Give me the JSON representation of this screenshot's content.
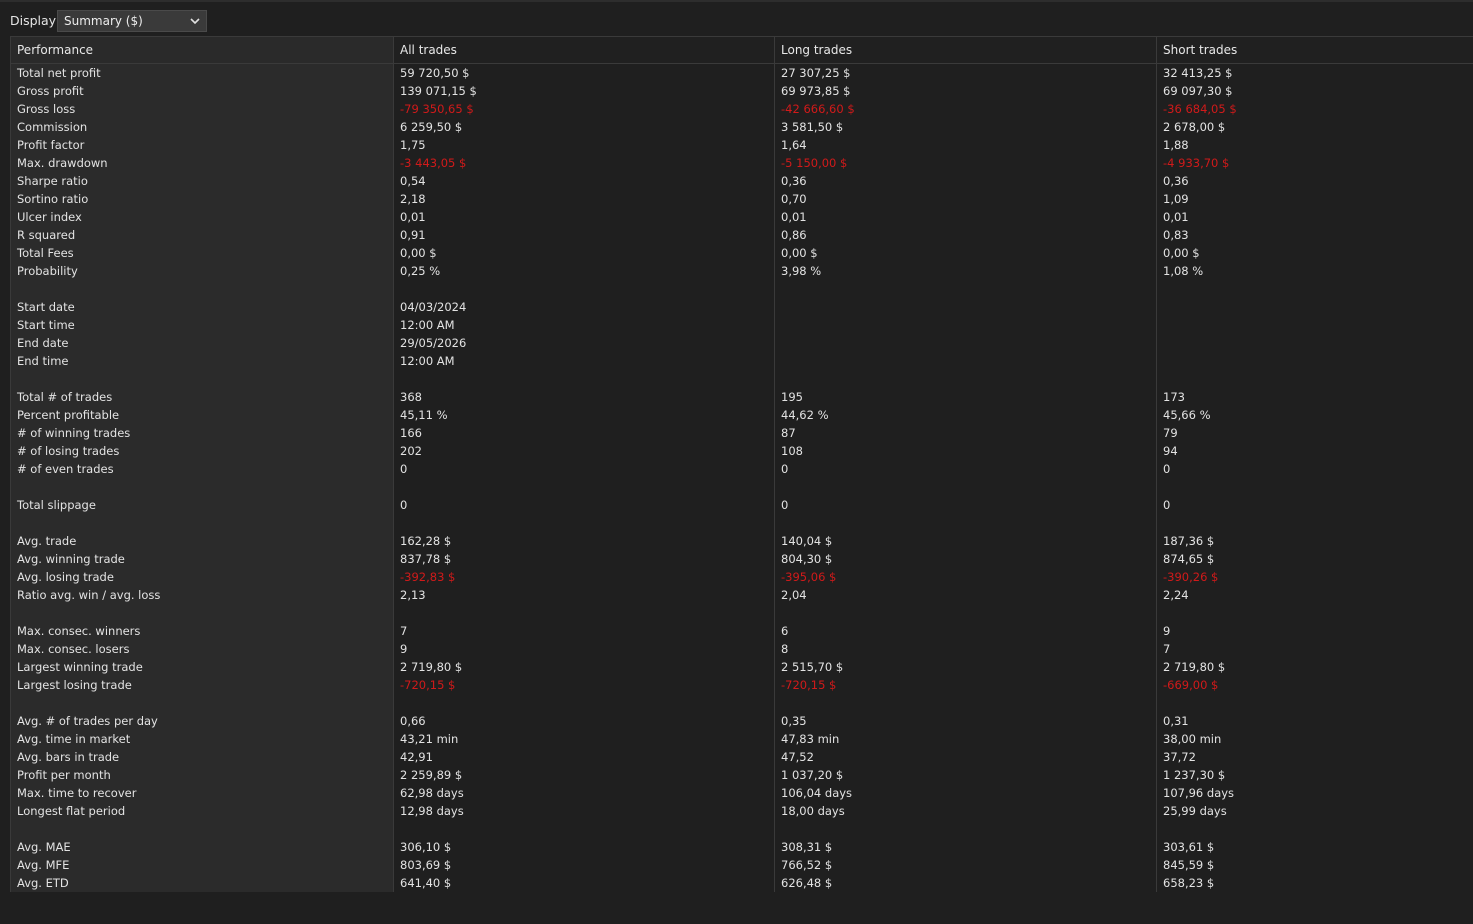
{
  "toolbar": {
    "display_label": "Display",
    "display_value": "Summary ($)",
    "chevron_icon": "chevron-down-icon"
  },
  "columns": [
    "Performance",
    "All trades",
    "Long trades",
    "Short trades"
  ],
  "colors": {
    "background": "#1f1f1f",
    "label_column": "#2b2b2b",
    "negative": "#d11a1a",
    "text": "#e3e3e3"
  },
  "rows": [
    {
      "label": "Total net profit",
      "all": "59 720,50 $",
      "long": "27 307,25 $",
      "short": "32 413,25 $",
      "neg": false
    },
    {
      "label": "Gross profit",
      "all": "139 071,15 $",
      "long": "69 973,85 $",
      "short": "69 097,30 $",
      "neg": false
    },
    {
      "label": "Gross loss",
      "all": "-79 350,65 $",
      "long": "-42 666,60 $",
      "short": "-36 684,05 $",
      "neg": true
    },
    {
      "label": "Commission",
      "all": "6 259,50 $",
      "long": "3 581,50 $",
      "short": "2 678,00 $",
      "neg": false
    },
    {
      "label": "Profit factor",
      "all": "1,75",
      "long": "1,64",
      "short": "1,88",
      "neg": false
    },
    {
      "label": "Max. drawdown",
      "all": "-3 443,05 $",
      "long": "-5 150,00 $",
      "short": "-4 933,70 $",
      "neg": true
    },
    {
      "label": "Sharpe ratio",
      "all": "0,54",
      "long": "0,36",
      "short": "0,36",
      "neg": false
    },
    {
      "label": "Sortino ratio",
      "all": "2,18",
      "long": "0,70",
      "short": "1,09",
      "neg": false
    },
    {
      "label": "Ulcer index",
      "all": "0,01",
      "long": "0,01",
      "short": "0,01",
      "neg": false
    },
    {
      "label": "R squared",
      "all": "0,91",
      "long": "0,86",
      "short": "0,83",
      "neg": false
    },
    {
      "label": "Total Fees",
      "all": "0,00 $",
      "long": "0,00 $",
      "short": "0,00 $",
      "neg": false
    },
    {
      "label": "Probability",
      "all": "0,25 %",
      "long": "3,98 %",
      "short": "1,08 %",
      "neg": false
    },
    {
      "label": "",
      "all": "",
      "long": "",
      "short": "",
      "neg": false
    },
    {
      "label": "Start date",
      "all": "04/03/2024",
      "long": "",
      "short": "",
      "neg": false
    },
    {
      "label": "Start time",
      "all": "12:00 AM",
      "long": "",
      "short": "",
      "neg": false
    },
    {
      "label": "End date",
      "all": "29/05/2026",
      "long": "",
      "short": "",
      "neg": false
    },
    {
      "label": "End time",
      "all": "12:00 AM",
      "long": "",
      "short": "",
      "neg": false
    },
    {
      "label": "",
      "all": "",
      "long": "",
      "short": "",
      "neg": false
    },
    {
      "label": "Total # of trades",
      "all": "368",
      "long": "195",
      "short": "173",
      "neg": false
    },
    {
      "label": "Percent profitable",
      "all": "45,11 %",
      "long": "44,62 %",
      "short": "45,66 %",
      "neg": false
    },
    {
      "label": "# of winning trades",
      "all": "166",
      "long": "87",
      "short": "79",
      "neg": false
    },
    {
      "label": "# of losing trades",
      "all": "202",
      "long": "108",
      "short": "94",
      "neg": false
    },
    {
      "label": "# of even trades",
      "all": "0",
      "long": "0",
      "short": "0",
      "neg": false
    },
    {
      "label": "",
      "all": "",
      "long": "",
      "short": "",
      "neg": false
    },
    {
      "label": "Total slippage",
      "all": "0",
      "long": "0",
      "short": "0",
      "neg": false
    },
    {
      "label": "",
      "all": "",
      "long": "",
      "short": "",
      "neg": false
    },
    {
      "label": "Avg. trade",
      "all": "162,28 $",
      "long": "140,04 $",
      "short": "187,36 $",
      "neg": false
    },
    {
      "label": "Avg. winning trade",
      "all": "837,78 $",
      "long": "804,30 $",
      "short": "874,65 $",
      "neg": false
    },
    {
      "label": "Avg. losing trade",
      "all": "-392,83 $",
      "long": "-395,06 $",
      "short": "-390,26 $",
      "neg": true
    },
    {
      "label": "Ratio avg. win / avg. loss",
      "all": "2,13",
      "long": "2,04",
      "short": "2,24",
      "neg": false
    },
    {
      "label": "",
      "all": "",
      "long": "",
      "short": "",
      "neg": false
    },
    {
      "label": "Max. consec. winners",
      "all": "7",
      "long": "6",
      "short": "9",
      "neg": false
    },
    {
      "label": "Max. consec. losers",
      "all": "9",
      "long": "8",
      "short": "7",
      "neg": false
    },
    {
      "label": "Largest winning trade",
      "all": "2 719,80 $",
      "long": "2 515,70 $",
      "short": "2 719,80 $",
      "neg": false
    },
    {
      "label": "Largest losing trade",
      "all": "-720,15 $",
      "long": "-720,15 $",
      "short": "-669,00 $",
      "neg": true
    },
    {
      "label": "",
      "all": "",
      "long": "",
      "short": "",
      "neg": false
    },
    {
      "label": "Avg. # of trades per day",
      "all": "0,66",
      "long": "0,35",
      "short": "0,31",
      "neg": false
    },
    {
      "label": "Avg. time in market",
      "all": "43,21 min",
      "long": "47,83 min",
      "short": "38,00 min",
      "neg": false
    },
    {
      "label": "Avg. bars in trade",
      "all": "42,91",
      "long": "47,52",
      "short": "37,72",
      "neg": false
    },
    {
      "label": "Profit per month",
      "all": "2 259,89 $",
      "long": "1 037,20 $",
      "short": "1 237,30 $",
      "neg": false
    },
    {
      "label": "Max. time to recover",
      "all": "62,98 days",
      "long": "106,04 days",
      "short": "107,96 days",
      "neg": false
    },
    {
      "label": "Longest flat period",
      "all": "12,98 days",
      "long": "18,00 days",
      "short": "25,99 days",
      "neg": false
    },
    {
      "label": "",
      "all": "",
      "long": "",
      "short": "",
      "neg": false
    },
    {
      "label": "Avg. MAE",
      "all": "306,10 $",
      "long": "308,31 $",
      "short": "303,61 $",
      "neg": false
    },
    {
      "label": "Avg. MFE",
      "all": "803,69 $",
      "long": "766,52 $",
      "short": "845,59 $",
      "neg": false
    },
    {
      "label": "Avg. ETD",
      "all": "641,40 $",
      "long": "626,48 $",
      "short": "658,23 $",
      "neg": false
    }
  ]
}
